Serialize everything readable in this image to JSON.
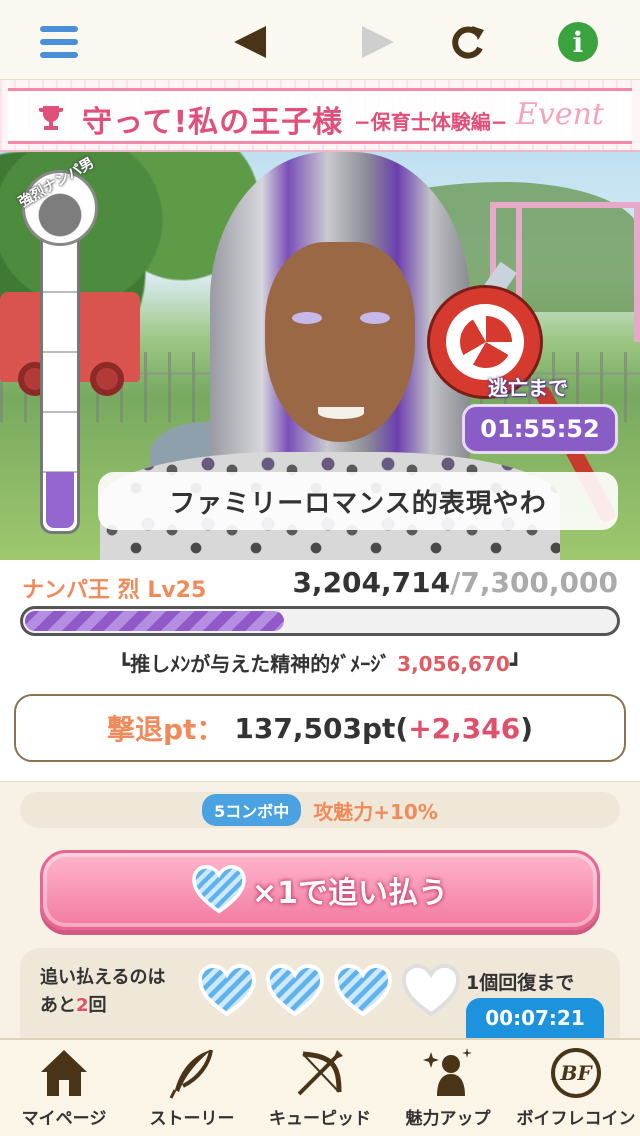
{
  "header": {
    "menu_icon": "hamburger-menu-icon",
    "back_icon": "triangle-left-icon",
    "forward_icon": "triangle-right-icon",
    "reload_icon": "reload-icon",
    "info_icon": "info-icon",
    "info_glyph": "i"
  },
  "event": {
    "title": "守って!私の王子様",
    "subtitle": "−保育士体験編−",
    "script_text": "Event"
  },
  "gauge": {
    "label": "強烈ナンパ男",
    "segments": 5,
    "filled_segments": 1
  },
  "timer": {
    "label": "逃亡まで",
    "value": "01:55:52"
  },
  "speech": {
    "text": "ファミリーロマンス的表現やわ"
  },
  "enemy": {
    "name": "ナンパ王 烈 Lv25",
    "hp_current": "3,204,714",
    "hp_max": "/7,300,000",
    "hp_fraction": 0.439
  },
  "damage": {
    "prefix": "┗推しﾒﾝが与えた精神的ﾀﾞﾒｰｼﾞ",
    "value": "3,056,670",
    "suffix": "┛"
  },
  "points": {
    "label": "撃退pt：",
    "value": "137,503pt",
    "open": " (",
    "bonus": "+2,346",
    "close": ")"
  },
  "combo": {
    "badge": "5コンボ中",
    "text": "攻魅力+10%"
  },
  "attack": {
    "label": "×1で追い払う",
    "icon": "striped-heart-icon"
  },
  "remaining": {
    "line1": "追い払えるのは",
    "prefix": "あと",
    "count": "2",
    "suffix": "回",
    "hearts": [
      "filled",
      "filled",
      "filled",
      "empty"
    ],
    "recover_label": "1個回復まで",
    "recover_time": "00:07:21"
  },
  "nav": [
    {
      "label": "マイページ",
      "icon": "house-icon"
    },
    {
      "label": "ストーリー",
      "icon": "quill-icon"
    },
    {
      "label": "キューピッド",
      "icon": "bow-arrow-icon"
    },
    {
      "label": "魅力アップ",
      "icon": "sparkle-person-icon"
    },
    {
      "label": "ボイフレコイン",
      "icon": "bf-coin-icon"
    }
  ],
  "colors": {
    "accent_pink": "#e0507a",
    "accent_orange": "#ef8b5a",
    "timer_purple": "#8a5cc6",
    "blue": "#1e93dd"
  }
}
